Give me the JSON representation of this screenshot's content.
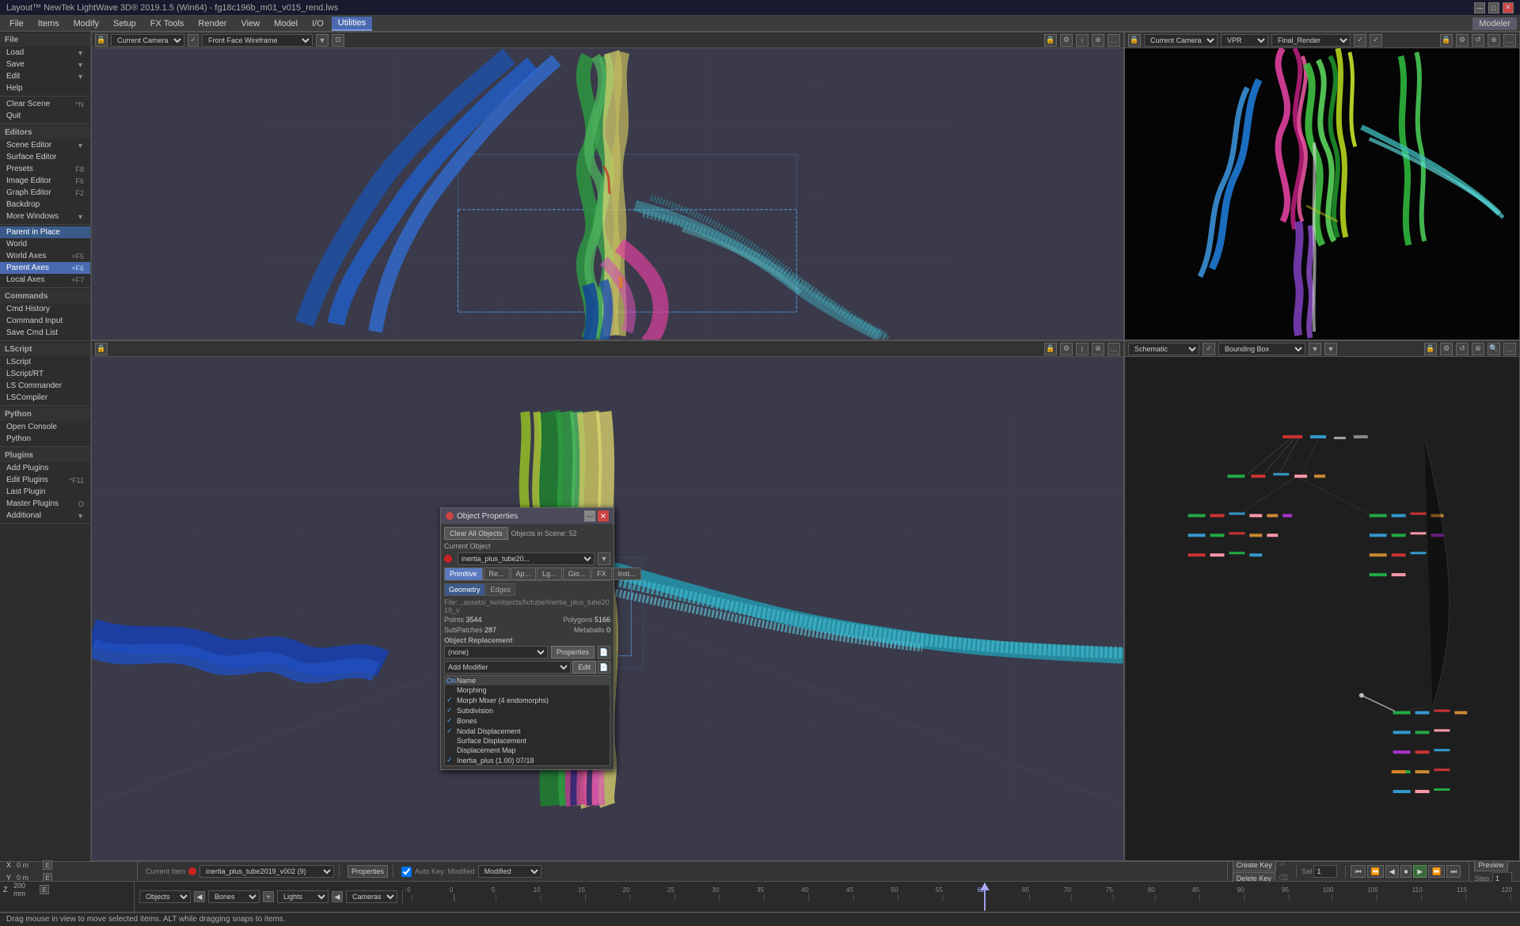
{
  "titleBar": {
    "text": "Layout™ NewTek LightWave 3D® 2019.1.5 (Win64) - fg18c196b_m01_v015_rend.lws",
    "controls": [
      "—",
      "□",
      "✕"
    ]
  },
  "menuBar": {
    "items": [
      {
        "label": "File",
        "active": false
      },
      {
        "label": "Items",
        "active": false
      },
      {
        "label": "Modify",
        "active": false
      },
      {
        "label": "Setup",
        "active": false
      },
      {
        "label": "FX Tools",
        "active": false
      },
      {
        "label": "Render",
        "active": false
      },
      {
        "label": "View",
        "active": false
      },
      {
        "label": "Model",
        "active": false
      },
      {
        "label": "I/O",
        "active": false
      },
      {
        "label": "Utilities",
        "active": true
      }
    ],
    "rightBtn": "Modeler"
  },
  "toolbar": {
    "leftCamera": "Current Camera",
    "leftMode": "Front Face Wireframe",
    "rightCamera": "Current Camera",
    "rightMode": "VPR",
    "rightMode2": "Final_Render"
  },
  "leftSidebar": {
    "fileSection": {
      "header": "File",
      "items": [
        {
          "label": "Load",
          "shortcut": ""
        },
        {
          "label": "Save",
          "shortcut": ""
        },
        {
          "label": "Edit",
          "shortcut": ""
        },
        {
          "label": "Help",
          "shortcut": ""
        }
      ]
    },
    "clearSection": {
      "items": [
        {
          "label": "Clear Scene",
          "shortcut": "^N"
        },
        {
          "label": "",
          "shortcut": "^N"
        },
        {
          "label": "Quit",
          "shortcut": ""
        }
      ]
    },
    "editorsSection": {
      "header": "Editors",
      "items": [
        {
          "label": "Scene Editor",
          "shortcut": ""
        },
        {
          "label": "Surface Editor",
          "shortcut": ""
        },
        {
          "label": "Presets",
          "shortcut": "F8"
        },
        {
          "label": "Image Editor",
          "shortcut": "F6"
        },
        {
          "label": "Graph Editor",
          "shortcut": "F2"
        },
        {
          "label": "Backdrop",
          "shortcut": ""
        },
        {
          "label": "More Windows",
          "shortcut": ""
        }
      ]
    },
    "parentSection": {
      "items": [
        {
          "label": "Parent in Place",
          "shortcut": "",
          "active": true
        },
        {
          "label": "World",
          "shortcut": ""
        },
        {
          "label": "World Axes",
          "shortcut": "+F5"
        },
        {
          "label": "Parent Axes",
          "shortcut": "+F6",
          "highlighted": true
        },
        {
          "label": "Local Axes",
          "shortcut": "+F7"
        }
      ]
    },
    "commandsSection": {
      "header": "Commands",
      "items": [
        {
          "label": "Cmd History",
          "shortcut": ""
        },
        {
          "label": "Command Input",
          "shortcut": ""
        },
        {
          "label": "Save Cmd List",
          "shortcut": ""
        }
      ]
    },
    "lscriptSection": {
      "header": "LScript",
      "items": [
        {
          "label": "LScript",
          "shortcut": ""
        },
        {
          "label": "LScript/RT",
          "shortcut": ""
        },
        {
          "label": "LS Commander",
          "shortcut": ""
        },
        {
          "label": "LSCompiler",
          "shortcut": ""
        }
      ]
    },
    "pythonSection": {
      "header": "Python",
      "items": [
        {
          "label": "Open Console",
          "shortcut": ""
        },
        {
          "label": "Python",
          "shortcut": ""
        }
      ]
    },
    "pluginsSection": {
      "header": "Plugins",
      "items": [
        {
          "label": "Add Plugins",
          "shortcut": ""
        },
        {
          "label": "Edit Plugins",
          "shortcut": "^F11"
        },
        {
          "label": "Last Plugin",
          "shortcut": ""
        },
        {
          "label": "Master Plugins",
          "shortcut": "O"
        },
        {
          "label": "Additional",
          "shortcut": "",
          "hasArrow": true
        }
      ]
    }
  },
  "viewport1": {
    "camera": "Current Camera",
    "mode": "Front Face Wireframe"
  },
  "viewport2": {
    "camera": "Current Camera",
    "mode": "VPR",
    "mode2": "Final_Render"
  },
  "viewport3": {
    "mode": "Schematic",
    "mode2": "Bounding Box"
  },
  "objectProperties": {
    "title": "Object Properties",
    "clearAllBtn": "Clear All Objects",
    "objectsInScene": "Objects in Scene: 52",
    "currentObjectLabel": "Current Object",
    "currentObject": "inertia_plus_tube20...",
    "tabs": [
      "Primitive",
      "Re...",
      "Ap...",
      "Lg...",
      "Glo...",
      "FX",
      "Inst..."
    ],
    "subtabs": [
      "Geometry",
      "Edges"
    ],
    "fileLabel": "File:",
    "fileValue": "..assets/_lw/objects/fx/tube/Inertia_plus_tube2019_v",
    "points": "3544",
    "polygons": "5166",
    "subpatches": "287",
    "metaballs": "0",
    "objectReplacementLabel": "Object Replacement",
    "replacementValue": "(none)",
    "propertiesBtn": "Properties",
    "addModifierLabel": "Add Modifier",
    "editBtn": "Edit",
    "modifierColumns": [
      "On",
      "Name"
    ],
    "modifiers": [
      {
        "on": false,
        "name": "Morphing"
      },
      {
        "on": true,
        "name": "Morph Mixer (4 endomorphs)"
      },
      {
        "on": true,
        "name": "Subdivision"
      },
      {
        "on": true,
        "name": "Bones"
      },
      {
        "on": true,
        "name": "Nodal Displacement"
      },
      {
        "on": false,
        "name": "Surface Displacement"
      },
      {
        "on": false,
        "name": "Displacement Map"
      },
      {
        "on": true,
        "name": "Inertia_plus (1.00) 07/18"
      }
    ]
  },
  "timeline": {
    "positions": [
      {
        "axis": "X",
        "value": "0 m",
        "extra": "E"
      },
      {
        "axis": "Y",
        "value": "0 m",
        "extra": "E"
      },
      {
        "axis": "Z",
        "value": "200 mm",
        "extra": "E"
      }
    ],
    "currentItem": "inertia_plus_tube2019_v002 (9)",
    "itemDot": "red",
    "tickMarks": [
      "-5",
      "0",
      "5",
      "10",
      "15",
      "20",
      "25",
      "30",
      "35",
      "40",
      "45",
      "50",
      "55",
      "62",
      "65",
      "70",
      "75",
      "80",
      "85",
      "90",
      "95",
      "100",
      "105",
      "110",
      "115",
      "120"
    ],
    "currentFrame": "62",
    "objects": "Objects",
    "bones": "Bones",
    "lights": "Lights",
    "cameras": "Cameras",
    "properties": "Properties",
    "sel": "Sel",
    "selNum": "1",
    "autoKey": "Auto Key: Modified",
    "createKey": "Create Key",
    "deleteKey": "Delete Key",
    "preview": "Preview",
    "step": "Step",
    "stepNum": "1"
  },
  "statusBar": {
    "text": "Drag mouse in view to move selected items. ALT while dragging snaps to items."
  },
  "colors": {
    "accent": "#5a7abf",
    "active": "#3a5a8a",
    "highlighted": "#4a6aaf",
    "bg": "#2a2a2a",
    "panel": "#3a3a3a",
    "border": "#555",
    "text": "#ccc",
    "muted": "#888"
  },
  "schematic": {
    "mode": "Schematic",
    "mode2": "Bounding Box"
  }
}
